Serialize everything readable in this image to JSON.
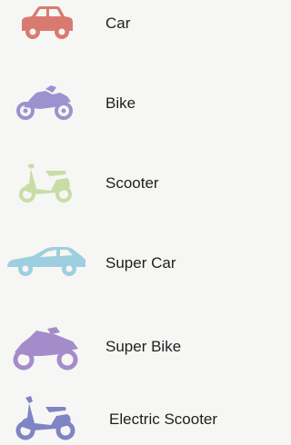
{
  "vehicles": [
    {
      "label": "Car",
      "icon": "car-icon",
      "color": "#d97a70"
    },
    {
      "label": "Bike",
      "icon": "bike-icon",
      "color": "#9b93cf"
    },
    {
      "label": "Scooter",
      "icon": "scooter-icon",
      "color": "#c9dca6"
    },
    {
      "label": "Super Car",
      "icon": "super-car-icon",
      "color": "#9ecfe0"
    },
    {
      "label": "Super Bike",
      "icon": "super-bike-icon",
      "color": "#a48ccb"
    },
    {
      "label": "Electric Scooter",
      "icon": "electric-scooter-icon",
      "color": "#7f84c4"
    }
  ]
}
